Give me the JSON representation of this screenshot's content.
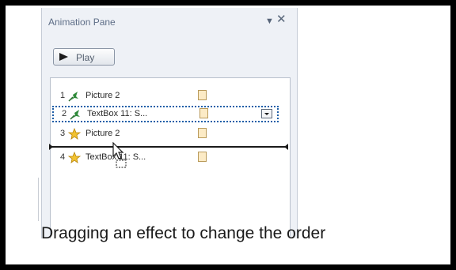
{
  "pane": {
    "title": "Animation Pane",
    "menu_icon": "dropdown-arrow",
    "close_icon": "close-x"
  },
  "play_button": {
    "label": "Play",
    "icon": "play-triangle"
  },
  "rows": [
    {
      "number": "1",
      "name": "Picture 2",
      "icon": "entrance-star-green",
      "selected": false
    },
    {
      "number": "2",
      "name": "TextBox 11: S...",
      "icon": "entrance-star-green",
      "selected": true
    },
    {
      "number": "3",
      "name": "Picture 2",
      "icon": "emphasis-star-yellow",
      "selected": false
    },
    {
      "number": "4",
      "name": "TextBox 11: S...",
      "icon": "emphasis-star-yellow",
      "selected": false
    }
  ],
  "caption": "Dragging an effect to change the order",
  "colors": {
    "pane_background": "#eef1f6",
    "selection_border": "#1f5fa8",
    "timing_bar": "#fcebc6",
    "frame": "#000000"
  }
}
